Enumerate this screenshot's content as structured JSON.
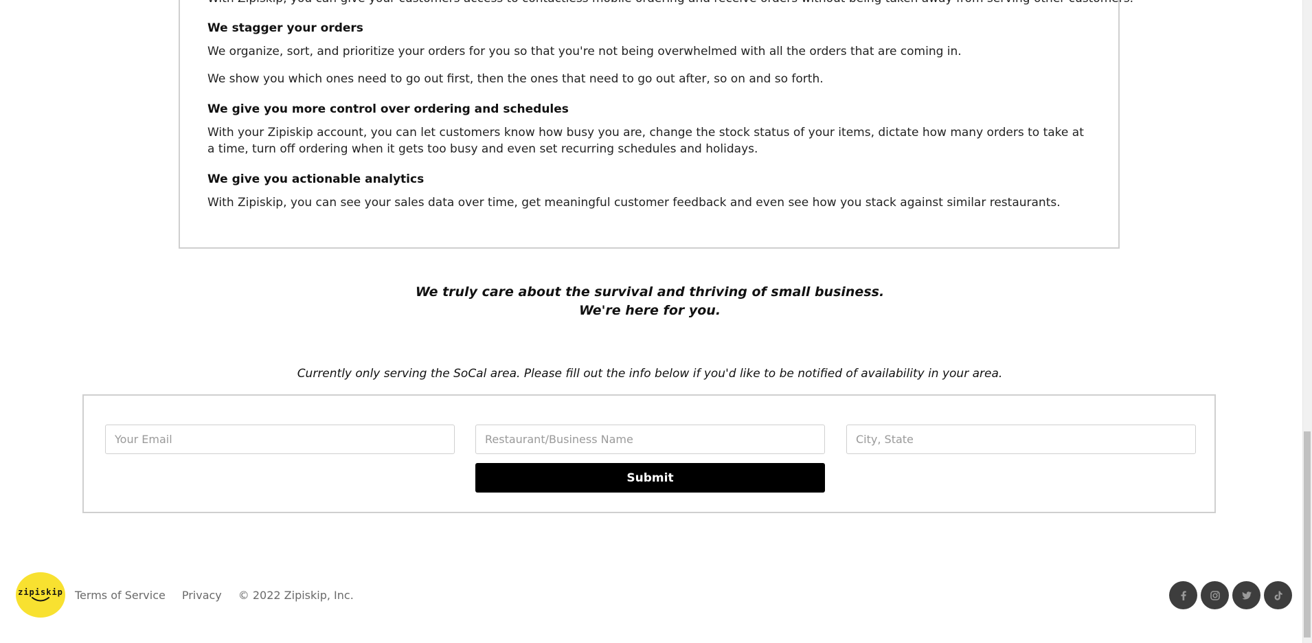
{
  "features": {
    "cut_text": "With Zipiskip, you can give your customers access to contactless mobile ordering and receive orders without being taken away from serving other customers.",
    "items": [
      {
        "heading": "We stagger your orders",
        "paragraphs": [
          "We organize, sort, and prioritize your orders for you so that you're not being overwhelmed with all the orders that are coming in.",
          "We show you which ones need to go out first, then the ones that need to go out after, so on and so forth."
        ]
      },
      {
        "heading": "We give you more control over ordering and schedules",
        "paragraphs": [
          "With your Zipiskip account, you can let customers know how busy you are, change the stock status of your items, dictate how many orders to take at a time, turn off ordering when it gets too busy and even set recurring schedules and holidays."
        ]
      },
      {
        "heading": "We give you actionable analytics",
        "paragraphs": [
          "With Zipiskip, you can see your sales data over time, get meaningful customer feedback and even see how you stack against similar restaurants."
        ]
      }
    ]
  },
  "tagline": {
    "line1": "We truly care about the survival and thriving of small business.",
    "line2": "We're here for you."
  },
  "notice": "Currently only serving the SoCal area. Please fill out the info below if you'd like to be notified of availability in your area.",
  "form": {
    "email_placeholder": "Your Email",
    "business_placeholder": "Restaurant/Business Name",
    "city_placeholder": "City, State",
    "email_value": "",
    "business_value": "",
    "city_value": "",
    "submit_label": "Submit"
  },
  "footer": {
    "logo_text": "zipiskip",
    "links": {
      "terms": "Terms of Service",
      "privacy": "Privacy"
    },
    "copyright": "© 2022 Zipiskip, Inc.",
    "social": [
      "facebook-icon",
      "instagram-icon",
      "twitter-icon",
      "tiktok-icon"
    ]
  },
  "colors": {
    "logo_bg": "#f8e130",
    "submit_bg": "#000000",
    "social_bg": "#3d3d3d",
    "border": "#cfcfcf"
  }
}
